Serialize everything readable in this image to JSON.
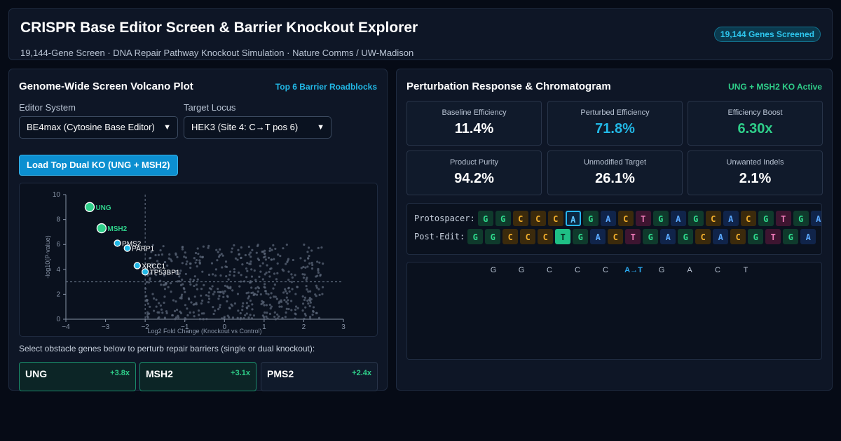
{
  "header": {
    "title": "CRISPR Base Editor Screen & Barrier Knockout Explorer",
    "subtitle_parts": [
      "19,144-Gene Screen",
      "DNA Repair Pathway Knockout Simulation",
      "Nature Comms / UW-Madison"
    ],
    "badge": "19,144 Genes Screened"
  },
  "left": {
    "title": "Genome-Wide Screen Volcano Plot",
    "tag": "Top 6 Barrier Roadblocks",
    "editor_label": "Editor System",
    "editor_value": "BE4max (Cytosine Base Editor)",
    "locus_label": "Target Locus",
    "locus_value": "HEK3 (Site 4: C→T pos 6)",
    "load_button": "Load Top Dual KO (UNG + MSH2)",
    "instruction": "Select obstacle genes below to perturb repair barriers (single or dual knockout):",
    "genes": [
      {
        "name": "UNG",
        "boost": "+3.8x",
        "active": true
      },
      {
        "name": "MSH2",
        "boost": "+3.1x",
        "active": true
      },
      {
        "name": "PMS2",
        "boost": "+2.4x",
        "active": false
      }
    ]
  },
  "chart_data": {
    "type": "scatter",
    "xlabel": "Log2 Fold Change (Knockout vs Control)",
    "ylabel": "-log10(P-value)",
    "xlim": [
      -4,
      3
    ],
    "ylim": [
      0,
      10
    ],
    "x_ticks": [
      "−4",
      "−3",
      "−2",
      "−1",
      "0",
      "1",
      "2",
      "3"
    ],
    "y_ticks": [
      "0",
      "2",
      "4",
      "6",
      "8",
      "10"
    ],
    "threshold_x": -2,
    "threshold_y": 3,
    "highlighted": [
      {
        "name": "UNG",
        "x": -3.4,
        "y": 9.0,
        "color": "#2fcf8a"
      },
      {
        "name": "MSH2",
        "x": -3.1,
        "y": 7.3,
        "color": "#2fcf8a"
      },
      {
        "name": "PMS2",
        "x": -2.7,
        "y": 6.1,
        "color": "#22b8e6"
      },
      {
        "name": "PARP1",
        "x": -2.45,
        "y": 5.7,
        "color": "#22b8e6"
      },
      {
        "name": "XRCC1",
        "x": -2.2,
        "y": 4.3,
        "color": "#22b8e6"
      },
      {
        "name": "TP53BP1",
        "x": -2.0,
        "y": 3.8,
        "color": "#22b8e6"
      }
    ],
    "background_color": "#5b6578"
  },
  "right": {
    "title": "Perturbation Response & Chromatogram",
    "tag": "UNG + MSH2 KO Active",
    "metrics": [
      {
        "label": "Baseline Efficiency",
        "value": "11.4%",
        "color": "#ffffff"
      },
      {
        "label": "Perturbed Efficiency",
        "value": "71.8%",
        "color": "#22b8e6"
      },
      {
        "label": "Efficiency Boost",
        "value": "6.30x",
        "color": "#2fcf8a"
      },
      {
        "label": "Product Purity",
        "value": "94.2%",
        "color": "#ffffff"
      },
      {
        "label": "Unmodified Target",
        "value": "26.1%",
        "color": "#ffffff"
      },
      {
        "label": "Unwanted Indels",
        "value": "2.1%",
        "color": "#ffffff"
      }
    ],
    "protospacer_label": "Protospacer:",
    "protospacer": [
      "G",
      "G",
      "C",
      "C",
      "C",
      "A",
      "G",
      "A",
      "C",
      "T",
      "G",
      "A",
      "G",
      "C",
      "A",
      "C",
      "G",
      "T",
      "G",
      "A"
    ],
    "protospacer_target_index": 5,
    "post_edit_label": "Post-Edit:",
    "post_edit": [
      "G",
      "G",
      "C",
      "C",
      "C",
      "T",
      "G",
      "A",
      "C",
      "T",
      "G",
      "A",
      "G",
      "C",
      "A",
      "C",
      "G",
      "T",
      "G",
      "A"
    ],
    "post_edit_index": 5,
    "chromatogram_bases": [
      "G",
      "G",
      "C",
      "C",
      "C",
      "A→T",
      "G",
      "A",
      "C",
      "T"
    ],
    "chromatogram_edit_index": 5
  }
}
